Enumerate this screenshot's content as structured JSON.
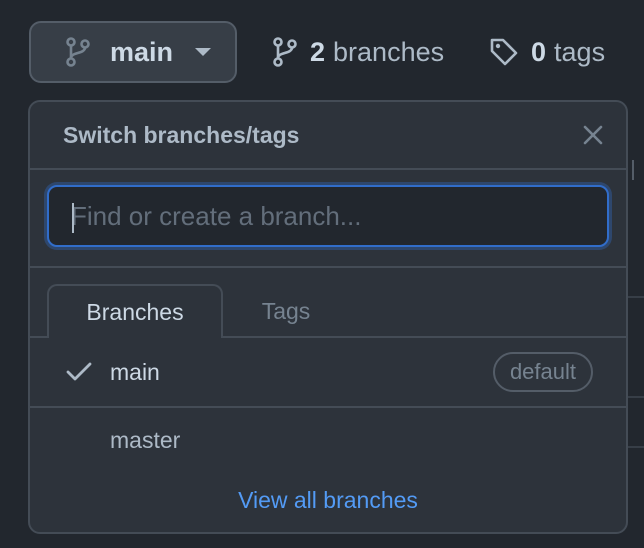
{
  "top_bar": {
    "branch_button": {
      "label": "main",
      "icon": "git-branch-icon",
      "caret": "caret-down-icon"
    },
    "branches_count": {
      "value": "2",
      "label": "branches",
      "icon": "git-branch-icon"
    },
    "tags_count": {
      "value": "0",
      "label": "tags",
      "icon": "tag-icon"
    }
  },
  "dropdown": {
    "title": "Switch branches/tags",
    "close_icon": "x-icon",
    "search": {
      "placeholder": "Find or create a branch...",
      "value": ""
    },
    "tabs": [
      {
        "label": "Branches",
        "selected": true
      },
      {
        "label": "Tags",
        "selected": false
      }
    ],
    "items": [
      {
        "name": "main",
        "checked": true,
        "badge": "default"
      },
      {
        "name": "master",
        "checked": false,
        "badge": ""
      }
    ],
    "view_all_label": "View all branches"
  },
  "colors": {
    "background": "#22272e",
    "panel": "#2d333b",
    "border": "#444c56",
    "accent_link": "#539bf5",
    "focus_ring": "#316dca"
  }
}
